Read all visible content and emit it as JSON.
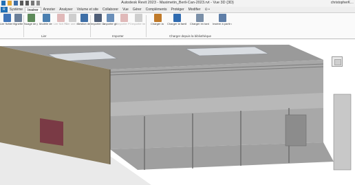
{
  "app": {
    "title": "Autodesk Revit 2023 - Maximetin_Berli-Can-2023.rvt - Vue 3D {3D}",
    "user": "christopherK…"
  },
  "tabs": [
    "R",
    "Système",
    "Insérer",
    "Annoter",
    "Analyser",
    "Volume et site",
    "Collaborer",
    "Vue",
    "Gérer",
    "Compléments",
    "Protéger",
    "Modifier",
    "⊙ •"
  ],
  "active_tab": "Insérer",
  "ribbon": {
    "buttons": [
      {
        "label": "Lier fichier IFC",
        "enabled": true
      },
      {
        "label": "Vignette",
        "enabled": true
      },
      {
        "label": "Nuage de points",
        "enabled": true
      },
      {
        "label": "Modèle de coordination",
        "enabled": true
      },
      {
        "label": "Lier fich PDF",
        "enabled": false
      },
      {
        "label": "Lier une image",
        "enabled": false
      },
      {
        "label": "Gestion des liens",
        "enabled": true
      },
      {
        "label": "Importer CAO",
        "enabled": true
      },
      {
        "label": "Importer gbXML",
        "enabled": true
      },
      {
        "label": "Importer PDF",
        "enabled": false
      },
      {
        "label": "Importer image",
        "enabled": false
      },
      {
        "label": "Charger la famille",
        "enabled": true
      },
      {
        "label": "Charger la famille Autodesk",
        "enabled": true
      },
      {
        "label": "Charger en tant que groupe",
        "enabled": true
      },
      {
        "label": "Insérer à partir du fichier",
        "enabled": true
      }
    ],
    "panels": [
      "Lier",
      "Importer",
      "Charger depuis la bibliothèque"
    ]
  },
  "colors": {
    "accent": "#1f6fb5",
    "wall": "#8b7e62",
    "wall_dark": "#6f6449",
    "slab": "#9c9c9c",
    "floor": "#a7a7a7",
    "ribbon_bg": "#fafafa"
  },
  "icons": [
    "revit-logo-icon",
    "open-icon",
    "save-icon",
    "undo-icon",
    "redo-icon",
    "print-icon",
    "measure-icon",
    "viewcube-icon",
    "home-icon"
  ]
}
